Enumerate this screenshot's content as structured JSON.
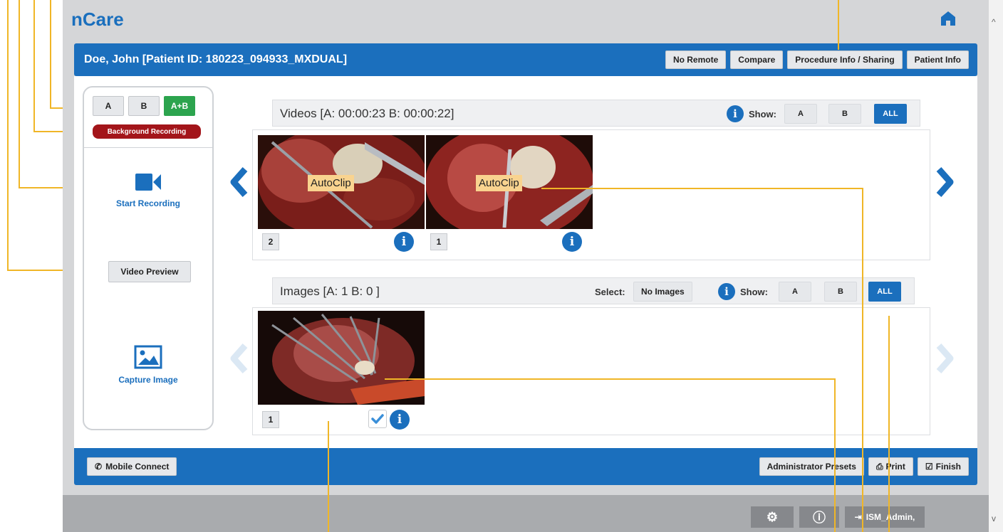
{
  "app": {
    "brand": "nCare"
  },
  "header": {
    "patient": "Doe, John  [Patient ID: 180223_094933_MXDUAL]",
    "buttons": {
      "no_remote": "No Remote",
      "compare": "Compare",
      "procedure_info": "Procedure Info / Sharing",
      "patient_info": "Patient Info"
    }
  },
  "left_panel": {
    "source_a": "A",
    "source_b": "B",
    "source_ab": "A+B",
    "background_recording": "Background Recording",
    "start_recording": "Start Recording",
    "video_preview": "Video Preview",
    "capture_image": "Capture Image"
  },
  "videos": {
    "title": "Videos [A: 00:00:23    B: 00:00:22]",
    "show_label": "Show:",
    "filter_a": "A",
    "filter_b": "B",
    "filter_all": "ALL",
    "active_filter": "ALL",
    "items": [
      {
        "badge": "2",
        "overlay": "AutoClip"
      },
      {
        "badge": "1",
        "overlay": "AutoClip"
      }
    ]
  },
  "images": {
    "title": "Images [A: 1    B: 0 ]",
    "select_label": "Select:",
    "select_value": "No Images",
    "show_label": "Show:",
    "filter_a": "A",
    "filter_b": "B",
    "filter_all": "ALL",
    "active_filter": "ALL",
    "items": [
      {
        "badge": "1",
        "selected": true
      }
    ]
  },
  "footer": {
    "mobile_connect": "Mobile Connect",
    "admin_presets": "Administrator Presets",
    "print": "Print",
    "finish": "Finish"
  },
  "status_bar": {
    "user": "ISM_Admin,"
  },
  "colors": {
    "brand_blue": "#1b6fbd",
    "recording_red": "#a3151a",
    "active_green": "#2ca44e",
    "callout_gold": "#f0b627",
    "autoclip_tag": "#f9d38f"
  },
  "icons": [
    "home-icon",
    "camera-icon",
    "image-icon",
    "info-icon",
    "chevron-left-icon",
    "chevron-right-icon",
    "checkbox-icon",
    "gear-icon",
    "logout-icon",
    "phone-icon",
    "printer-icon",
    "check-square-icon"
  ]
}
